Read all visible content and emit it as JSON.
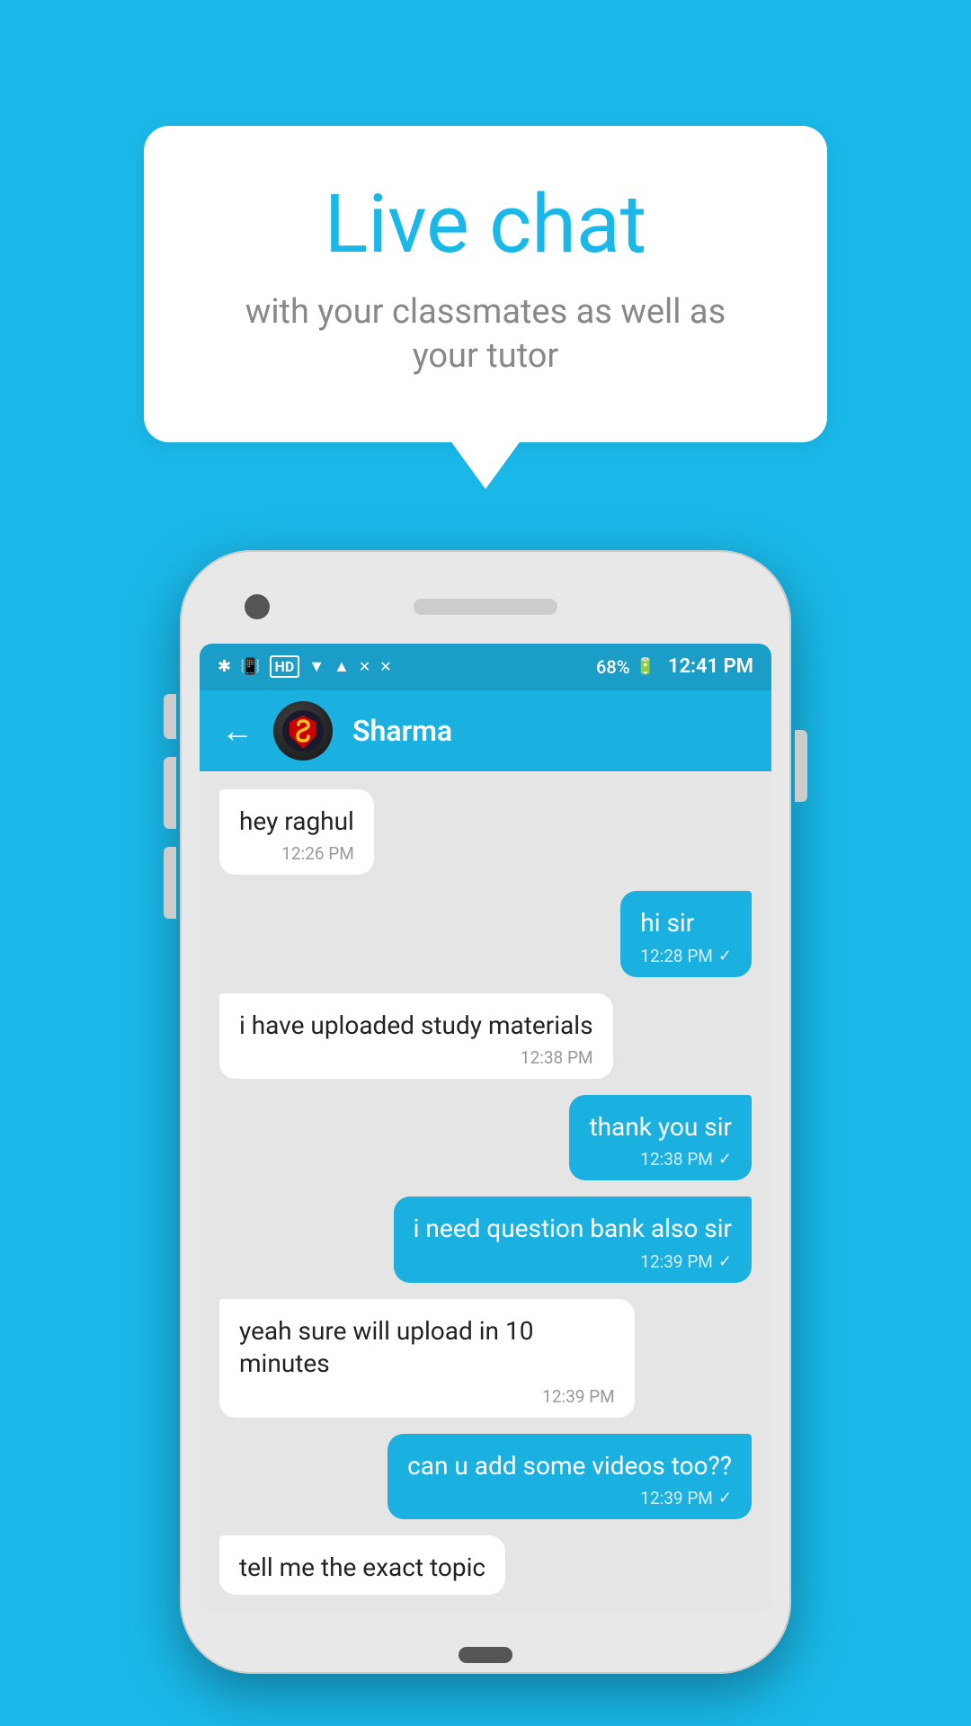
{
  "background": {
    "color": "#1ab8e8"
  },
  "speech_bubble": {
    "title": "Live chat",
    "subtitle": "with your classmates as well as your tutor"
  },
  "status_bar": {
    "time": "12:41 PM",
    "battery": "68%",
    "icons": [
      "bluetooth",
      "vibrate",
      "hd",
      "wifi",
      "signal",
      "cross1",
      "cross2"
    ]
  },
  "chat_header": {
    "user_name": "Sharma",
    "back_label": "←"
  },
  "messages": [
    {
      "id": 1,
      "type": "incoming",
      "text": "hey raghul",
      "time": "12:26 PM",
      "tick": false
    },
    {
      "id": 2,
      "type": "outgoing",
      "text": "hi sir",
      "time": "12:28 PM",
      "tick": true
    },
    {
      "id": 3,
      "type": "incoming",
      "text": "i have uploaded study materials",
      "time": "12:38 PM",
      "tick": false
    },
    {
      "id": 4,
      "type": "outgoing",
      "text": "thank you sir",
      "time": "12:38 PM",
      "tick": true
    },
    {
      "id": 5,
      "type": "outgoing",
      "text": "i need question bank also sir",
      "time": "12:39 PM",
      "tick": true
    },
    {
      "id": 6,
      "type": "incoming",
      "text": "yeah sure will upload in 10 minutes",
      "time": "12:39 PM",
      "tick": false
    },
    {
      "id": 7,
      "type": "outgoing",
      "text": "can u add some videos too??",
      "time": "12:39 PM",
      "tick": true
    },
    {
      "id": 8,
      "type": "incoming",
      "text": "tell me the exact topic",
      "time": "",
      "tick": false,
      "partial": true
    }
  ]
}
